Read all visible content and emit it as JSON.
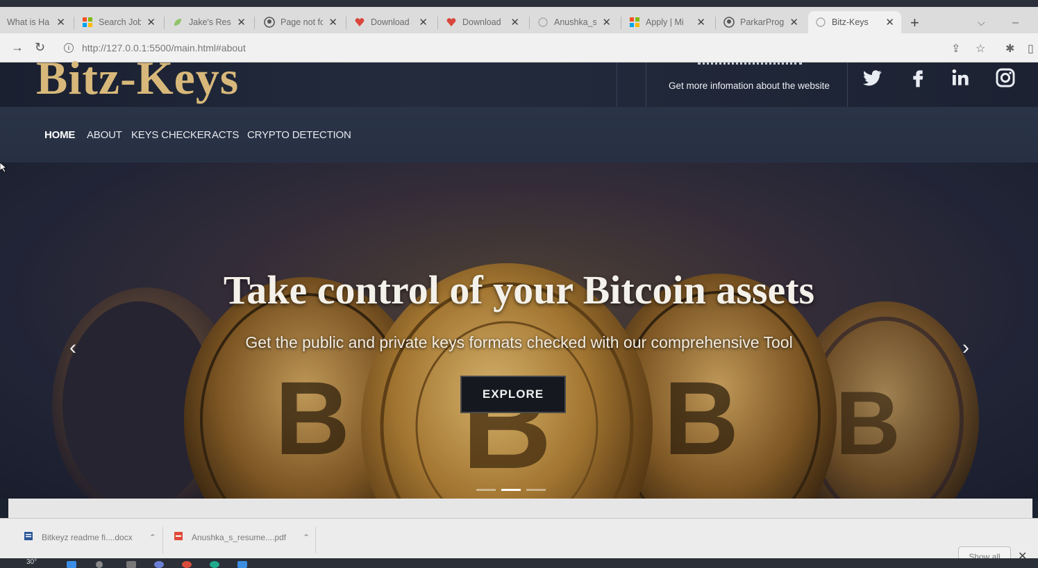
{
  "browser": {
    "tabs": [
      {
        "label": "What is Ha",
        "icon": "globe-icon"
      },
      {
        "label": "Search Job",
        "icon": "microsoft-icon"
      },
      {
        "label": "Jake's Resu",
        "icon": "leaf-icon"
      },
      {
        "label": "Page not fo",
        "icon": "github-icon"
      },
      {
        "label": "Download",
        "icon": "heart-icon"
      },
      {
        "label": "Download",
        "icon": "heart-icon"
      },
      {
        "label": "Anushka_s",
        "icon": "globe-icon"
      },
      {
        "label": "Apply | Mi",
        "icon": "microsoft-icon"
      },
      {
        "label": "ParkarProg",
        "icon": "github-icon"
      },
      {
        "label": "Bitz-Keys",
        "icon": "globe-icon"
      }
    ],
    "new_tab": "+",
    "url": "http://127.0.0.1:5500/main.html#about"
  },
  "site": {
    "logo": "Bitz-Keys",
    "info_text": "Get more infomation about the website",
    "social": [
      "twitter-icon",
      "facebook-icon",
      "linkedin-icon",
      "instagram-icon"
    ],
    "nav": [
      "HOME",
      "ABOUT",
      "KEYS CHECKER",
      "ACTS",
      "CRYPTO DETECTION"
    ]
  },
  "hero": {
    "title": "Take control of your Bitcoin assets",
    "subtitle": "Get the public and private keys formats checked with our comprehensive Tool",
    "button": "EXPLORE"
  },
  "downloads": {
    "items": [
      "Bitkeyz readme fi....docx",
      "Anushka_s_resume....pdf"
    ],
    "show_all": "Show all"
  },
  "taskbar": {
    "temperature": "30°"
  },
  "colors": {
    "accent_gold": "#d8b87a",
    "header_dark": "#1a2030",
    "nav_bg": "#2a3447"
  }
}
